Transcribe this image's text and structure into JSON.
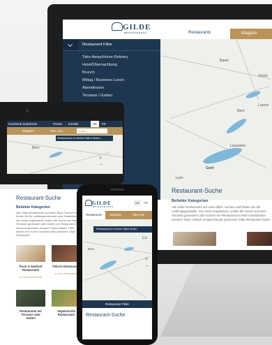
{
  "brand": {
    "name": "GILDE",
    "subtitle": "RESTAURANTS"
  },
  "desktop": {
    "nav": [
      "Restaurants",
      "Magazin"
    ],
    "filter_title": "Restaurant Filter",
    "filter_items": [
      "Take-Away/Home-Delivery",
      "Hotel/Übernachtung",
      "Brunch",
      "Mittag / Business-Lunch",
      "Abendessen",
      "Terrasse / Garten"
    ],
    "map_labels": [
      "Basel",
      "Zürich",
      "Bern",
      "Luzern",
      "Genf",
      "Lyon",
      "Lausanne"
    ],
    "section_title": "Restaurant-Suche",
    "categories_title": "Beliebte Kategorien",
    "body": "Alle Gilde Restaurants auf einen Blick. Suchen und finden Sie die Lieblingsgaststätte. Sie essen vegetarisch, wollen die Sonne auf einer Terrasse geniessen oder suchen ein Restaurant in einem bestimmten Kanton? Ganz einfach entsprechende passende Gilde Restaurant finden."
  },
  "tablet": {
    "topnav": [
      "Geschenk-Gutscheine",
      "Presse",
      "Kontakt",
      "DE",
      "FR"
    ],
    "menu": [
      "Magazin",
      "Über uns"
    ],
    "search_placeholder": "Suche",
    "nearby_button": "Restaurants in meiner Nähe finden",
    "map_labels": [
      "Bern"
    ],
    "section_title": "Restaurant-Suche",
    "categories_title": "Beliebte Kategorien",
    "body": "Alle Gilde-Restaurants auf einen Blick. Suchen und finden Sie Ihr Lieblingsrestaurant oder Gaststätte. Sie essen vegetarisch, wollen die Sonne auf einer Terrasse geniessen oder wollen ein Restaurant in einem bestimmten Kanton? Ganz einfach Filter setzen und schon erscheint das passende Gilde Restaurant.",
    "tiles": [
      {
        "label": "Fisch & Seafood Restaurants",
        "link": "zu den Restaurants"
      },
      {
        "label": "Fleisch Restaurants",
        "link": "zu den Restaurants"
      },
      {
        "label": "Restaurants mit Terrasse oder Garten",
        "link": ""
      },
      {
        "label": "Vegetarische Restaurants",
        "link": ""
      }
    ]
  },
  "phone": {
    "lang": [
      "DE",
      "FR"
    ],
    "menu": [
      "Restaurants",
      "Magazin",
      "Über uns"
    ],
    "nearby_button": "Restaurants in meiner Nähe finden",
    "map_labels": [
      "Bern",
      "Lu"
    ],
    "filter_button": "Restaurant Filter",
    "section_title": "Restaurant-Suche"
  },
  "colors": {
    "navy": "#1f3650",
    "gold": "#b9935a"
  }
}
